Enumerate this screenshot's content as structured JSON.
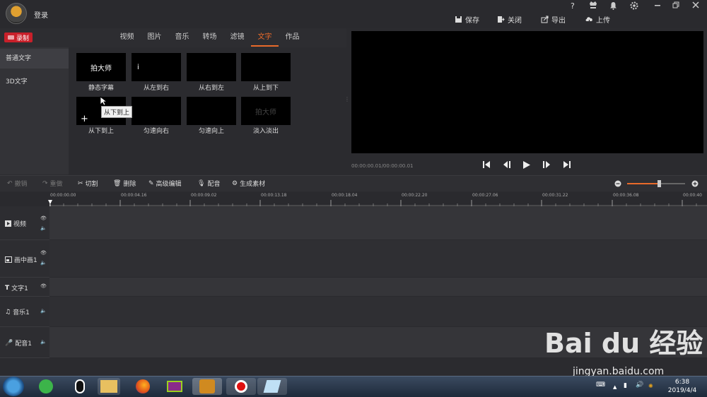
{
  "header": {
    "login": "登录",
    "save": "保存",
    "close": "关闭",
    "export": "导出",
    "upload": "上传",
    "help": "?"
  },
  "record": "录制",
  "tabs": [
    "视频",
    "图片",
    "音乐",
    "转场",
    "滤镜",
    "文字",
    "作品"
  ],
  "active_tab": "文字",
  "sidebar": [
    "普通文字",
    "3D文字"
  ],
  "thumbs": [
    {
      "label": "静态字幕",
      "text": "拍大师"
    },
    {
      "label": "从左到右",
      "text": "i"
    },
    {
      "label": "从右到左",
      "text": ""
    },
    {
      "label": "从上到下",
      "text": ""
    },
    {
      "label": "从下到上",
      "text": "+"
    },
    {
      "label": "匀速向右",
      "text": ""
    },
    {
      "label": "匀速向上",
      "text": ""
    },
    {
      "label": "淡入淡出",
      "text": "拍大师"
    }
  ],
  "tooltip": "从下到上",
  "timecode": "00:00:00.01/00:00:00.01",
  "toolbar": {
    "undo": "撤销",
    "redo": "重做",
    "cut": "切割",
    "delete": "删除",
    "advanced": "高级编辑",
    "dub": "配音",
    "generate": "生成素材"
  },
  "ruler": [
    "00:00:00.00",
    "00:00:04.16",
    "00:00:09.02",
    "00:00:13.18",
    "00:00:18.04",
    "00:00:22.20",
    "00:00:27.06",
    "00:00:31.22",
    "00:00:36.08",
    "00:00:40"
  ],
  "tracks": [
    "视频",
    "画中画1",
    "文字1",
    "音乐1",
    "配音1"
  ],
  "clock": {
    "time": "6:38",
    "date": "2019/4/4"
  },
  "watermark": {
    "brand": "Bai du 经验",
    "url": "jingyan.baidu.com"
  }
}
